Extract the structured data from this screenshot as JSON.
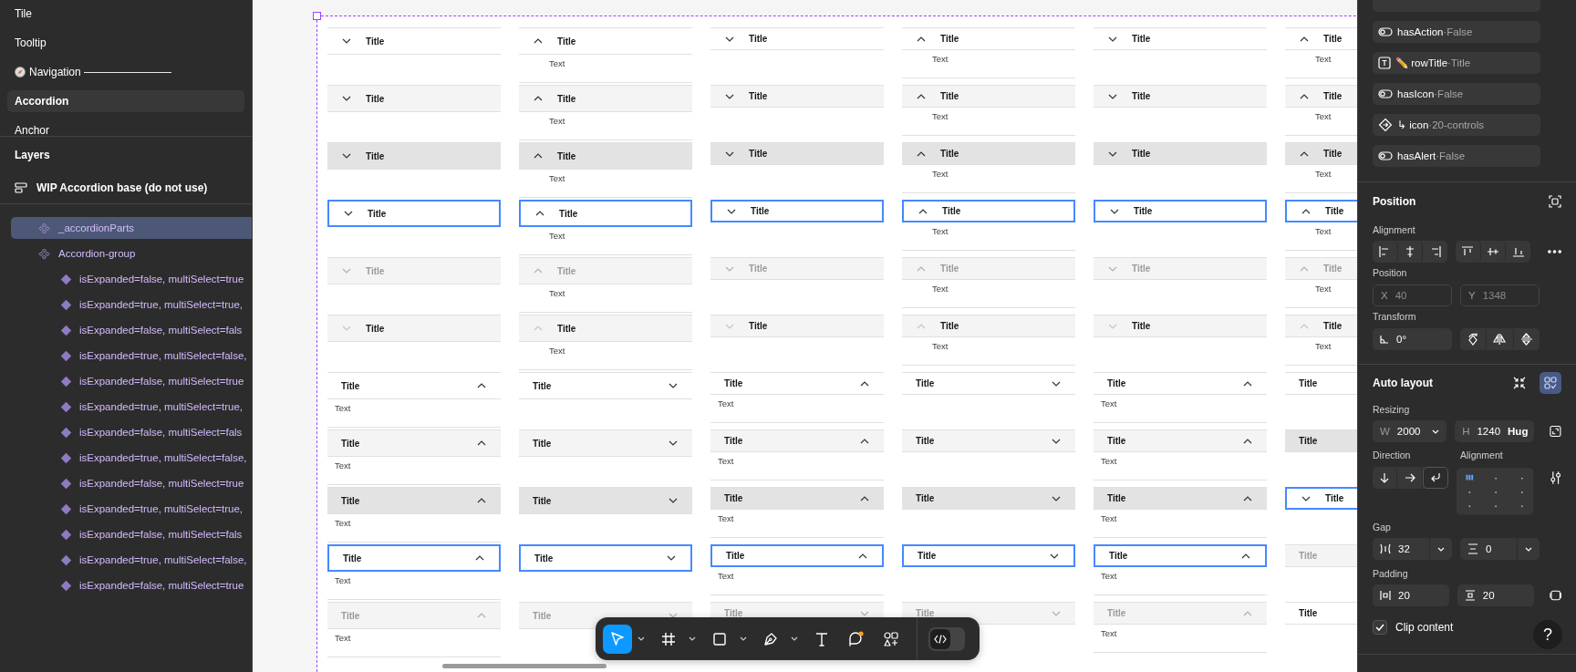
{
  "left_panel": {
    "pages": [
      {
        "label": "Tile",
        "kind": "plain",
        "selected": false
      },
      {
        "label": "Tooltip",
        "kind": "plain",
        "selected": false
      },
      {
        "label": "Navigation ————————",
        "kind": "emoji",
        "selected": false
      },
      {
        "label": "Accordion",
        "kind": "plain",
        "selected": true
      },
      {
        "label": "Anchor",
        "kind": "plain",
        "selected": false
      }
    ],
    "layers_title": "Layers",
    "frame": {
      "label": "WIP Accordion base (do not use)"
    },
    "layers": [
      {
        "label": "_accordionParts",
        "kind": "component-set",
        "selected": true
      },
      {
        "label": "Accordion-group",
        "kind": "component-set",
        "selected": false
      },
      {
        "label": "isExpanded=false, multiSelect=true",
        "kind": "variant",
        "selected": false
      },
      {
        "label": "isExpanded=true, multiSelect=true,",
        "kind": "variant",
        "selected": false
      },
      {
        "label": "isExpanded=false, multiSelect=fals",
        "kind": "variant",
        "selected": false
      },
      {
        "label": "isExpanded=true, multiSelect=false,",
        "kind": "variant",
        "selected": false
      },
      {
        "label": "isExpanded=false, multiSelect=true",
        "kind": "variant",
        "selected": false
      },
      {
        "label": "isExpanded=true, multiSelect=true,",
        "kind": "variant",
        "selected": false
      },
      {
        "label": "isExpanded=false, multiSelect=fals",
        "kind": "variant",
        "selected": false
      },
      {
        "label": "isExpanded=true, multiSelect=false,",
        "kind": "variant",
        "selected": false
      },
      {
        "label": "isExpanded=false, multiSelect=true",
        "kind": "variant",
        "selected": false
      },
      {
        "label": "isExpanded=true, multiSelect=true,",
        "kind": "variant",
        "selected": false
      },
      {
        "label": "isExpanded=false, multiSelect=fals",
        "kind": "variant",
        "selected": false
      },
      {
        "label": "isExpanded=true, multiSelect=false,",
        "kind": "variant",
        "selected": false
      },
      {
        "label": "isExpanded=false, multiSelect=true",
        "kind": "variant",
        "selected": false
      }
    ]
  },
  "canvas": {
    "columns": [
      {
        "kind": "large",
        "cells": [
          {
            "title": "Title",
            "kind": "default",
            "expanded": false,
            "chevron_right": false
          },
          {
            "title": "Title",
            "kind": "hover",
            "expanded": false,
            "chevron_right": false
          },
          {
            "title": "Title",
            "kind": "pressed",
            "expanded": false,
            "chevron_right": false
          },
          {
            "title": "Title",
            "kind": "focus",
            "expanded": false,
            "chevron_right": false
          },
          {
            "title": "Title",
            "kind": "disabled",
            "expanded": false,
            "chevron_right": false
          },
          {
            "title": "Title",
            "kind": "subtle",
            "expanded": false,
            "chevron_right": false
          },
          {
            "title": "Title",
            "kind": "default",
            "expanded": true,
            "chevron_right": true,
            "text": "Text"
          },
          {
            "title": "Title",
            "kind": "hover",
            "expanded": true,
            "chevron_right": true,
            "text": "Text"
          },
          {
            "title": "Title",
            "kind": "pressed",
            "expanded": true,
            "chevron_right": true,
            "text": "Text"
          },
          {
            "title": "Title",
            "kind": "focus",
            "expanded": true,
            "chevron_right": true,
            "text": "Text"
          },
          {
            "title": "Title",
            "kind": "disabled",
            "expanded": true,
            "chevron_right": true,
            "text": "Text"
          }
        ]
      },
      {
        "kind": "large",
        "cells": [
          {
            "title": "Title",
            "kind": "default",
            "expanded": true,
            "chevron_right": false,
            "text": "Text"
          },
          {
            "title": "Title",
            "kind": "hover",
            "expanded": true,
            "chevron_right": false,
            "text": "Text"
          },
          {
            "title": "Title",
            "kind": "pressed",
            "expanded": true,
            "chevron_right": false,
            "text": "Text"
          },
          {
            "title": "Title",
            "kind": "focus",
            "expanded": true,
            "chevron_right": false,
            "text": "Text"
          },
          {
            "title": "Title",
            "kind": "disabled",
            "expanded": true,
            "chevron_right": false,
            "text": "Text"
          },
          {
            "title": "Title",
            "kind": "subtle",
            "expanded": true,
            "chevron_right": false,
            "text": "Text"
          },
          {
            "title": "Title",
            "kind": "default",
            "expanded": false,
            "chevron_right": true
          },
          {
            "title": "Title",
            "kind": "hover",
            "expanded": false,
            "chevron_right": true
          },
          {
            "title": "Title",
            "kind": "pressed",
            "expanded": false,
            "chevron_right": true
          },
          {
            "title": "Title",
            "kind": "focus",
            "expanded": false,
            "chevron_right": true
          },
          {
            "title": "Title",
            "kind": "disabled",
            "expanded": false,
            "chevron_right": true
          }
        ]
      },
      {
        "kind": "small",
        "cells": [
          {
            "title": "Title",
            "kind": "default",
            "expanded": false,
            "chevron_right": false
          },
          {
            "title": "Title",
            "kind": "hover",
            "expanded": false,
            "chevron_right": false
          },
          {
            "title": "Title",
            "kind": "pressed",
            "expanded": false,
            "chevron_right": false
          },
          {
            "title": "Title",
            "kind": "focus",
            "expanded": false,
            "chevron_right": false
          },
          {
            "title": "Title",
            "kind": "disabled",
            "expanded": false,
            "chevron_right": false
          },
          {
            "title": "Title",
            "kind": "subtle",
            "expanded": false,
            "chevron_right": false
          },
          {
            "title": "Title",
            "kind": "default",
            "expanded": true,
            "chevron_right": true,
            "text": "Text"
          },
          {
            "title": "Title",
            "kind": "hover",
            "expanded": true,
            "chevron_right": true,
            "text": "Text"
          },
          {
            "title": "Title",
            "kind": "pressed",
            "expanded": true,
            "chevron_right": true,
            "text": "Text"
          },
          {
            "title": "Title",
            "kind": "focus",
            "expanded": true,
            "chevron_right": true,
            "text": "Text"
          },
          {
            "title": "Title",
            "kind": "disabled",
            "expanded": false,
            "chevron_right": true
          }
        ]
      },
      {
        "kind": "small",
        "cells": [
          {
            "title": "Title",
            "kind": "default",
            "expanded": true,
            "chevron_right": false,
            "text": "Text"
          },
          {
            "title": "Title",
            "kind": "hover",
            "expanded": true,
            "chevron_right": false,
            "text": "Text"
          },
          {
            "title": "Title",
            "kind": "pressed",
            "expanded": true,
            "chevron_right": false,
            "text": "Text"
          },
          {
            "title": "Title",
            "kind": "focus",
            "expanded": true,
            "chevron_right": false,
            "text": "Text"
          },
          {
            "title": "Title",
            "kind": "disabled",
            "expanded": true,
            "chevron_right": false,
            "text": "Text"
          },
          {
            "title": "Title",
            "kind": "subtle",
            "expanded": true,
            "chevron_right": false,
            "text": "Text"
          },
          {
            "title": "Title",
            "kind": "default",
            "expanded": false,
            "chevron_right": true
          },
          {
            "title": "Title",
            "kind": "hover",
            "expanded": false,
            "chevron_right": true
          },
          {
            "title": "Title",
            "kind": "pressed",
            "expanded": false,
            "chevron_right": true
          },
          {
            "title": "Title",
            "kind": "focus",
            "expanded": false,
            "chevron_right": true
          },
          {
            "title": "Title",
            "kind": "disabled",
            "expanded": false,
            "chevron_right": true
          }
        ]
      },
      {
        "kind": "small",
        "cells": [
          {
            "title": "Title",
            "kind": "default",
            "expanded": false,
            "chevron_right": false
          },
          {
            "title": "Title",
            "kind": "hover",
            "expanded": false,
            "chevron_right": false
          },
          {
            "title": "Title",
            "kind": "pressed",
            "expanded": false,
            "chevron_right": false
          },
          {
            "title": "Title",
            "kind": "focus",
            "expanded": false,
            "chevron_right": false
          },
          {
            "title": "Title",
            "kind": "disabled",
            "expanded": false,
            "chevron_right": false
          },
          {
            "title": "Title",
            "kind": "subtle",
            "expanded": false,
            "chevron_right": false
          },
          {
            "title": "Title",
            "kind": "default",
            "expanded": true,
            "chevron_right": true,
            "text": "Text"
          },
          {
            "title": "Title",
            "kind": "hover",
            "expanded": true,
            "chevron_right": true,
            "text": "Text"
          },
          {
            "title": "Title",
            "kind": "pressed",
            "expanded": true,
            "chevron_right": true,
            "text": "Text"
          },
          {
            "title": "Title",
            "kind": "focus",
            "expanded": true,
            "chevron_right": true,
            "text": "Text"
          },
          {
            "title": "Title",
            "kind": "disabled",
            "expanded": true,
            "chevron_right": true,
            "text": "Text"
          }
        ]
      },
      {
        "kind": "small",
        "cells": [
          {
            "title": "Title",
            "kind": "default",
            "expanded": true,
            "chevron_right": false,
            "text": "Text"
          },
          {
            "title": "Title",
            "kind": "hover",
            "expanded": true,
            "chevron_right": false,
            "text": "Text"
          },
          {
            "title": "Title",
            "kind": "pressed",
            "expanded": true,
            "chevron_right": false,
            "text": "Text"
          },
          {
            "title": "Title",
            "kind": "focus",
            "expanded": true,
            "chevron_right": false,
            "text": "Text"
          },
          {
            "title": "Title",
            "kind": "disabled",
            "expanded": true,
            "chevron_right": false,
            "text": "Text"
          },
          {
            "title": "Title",
            "kind": "subtle",
            "expanded": true,
            "chevron_right": false,
            "text": "Text"
          },
          {
            "title": "Title",
            "kind": "default",
            "expanded": false,
            "chevron_right": true
          },
          {
            "title": "Title",
            "kind": "pressed",
            "expanded": false,
            "chevron_right": true
          },
          {
            "title": "Title",
            "kind": "focus",
            "expanded": false,
            "chevron_right": false
          },
          {
            "title": "Title",
            "kind": "disabled",
            "expanded": false,
            "chevron_right": true
          },
          {
            "title": "Title",
            "kind": "default",
            "expanded": false,
            "chevron_right": true
          }
        ]
      }
    ]
  },
  "toolbar": {
    "tools": [
      {
        "kind": "move",
        "selected": true,
        "menu": true
      },
      {
        "kind": "frame",
        "selected": false,
        "menu": true
      },
      {
        "kind": "rectangle",
        "selected": false,
        "menu": true
      },
      {
        "kind": "pen",
        "selected": false,
        "menu": true
      },
      {
        "kind": "text",
        "selected": false,
        "menu": false
      },
      {
        "kind": "comment",
        "selected": false,
        "menu": false,
        "badge": true
      },
      {
        "kind": "actions",
        "selected": false,
        "menu": false
      }
    ],
    "dev_mode": {
      "on": false
    }
  },
  "right_panel": {
    "properties": [
      {
        "kind": "boolean",
        "name": "hasAction",
        "value": "·False"
      },
      {
        "kind": "text",
        "name": "✏️ rowTitle",
        "value": "·Title"
      },
      {
        "kind": "boolean",
        "name": "hasIcon",
        "value": "·False"
      },
      {
        "kind": "instance",
        "name": "↳ icon",
        "value": "·20-controls"
      },
      {
        "kind": "boolean",
        "name": "hasAlert",
        "value": "·False"
      }
    ],
    "position": {
      "title": "Position",
      "alignment_label": "Alignment",
      "position_label": "Position",
      "x": {
        "label": "X",
        "value": "40",
        "disabled": true
      },
      "y": {
        "label": "Y",
        "value": "1348",
        "disabled": true
      },
      "transform_label": "Transform",
      "rotation": "0°"
    },
    "auto_layout": {
      "title": "Auto layout",
      "modes": [
        {
          "kind": "collapse",
          "selected": false
        },
        {
          "kind": "grid",
          "selected": true
        }
      ],
      "resizing_label": "Resizing",
      "width": {
        "label": "W",
        "value": "2000"
      },
      "height": {
        "label": "H",
        "value": "1240",
        "mode": "Hug"
      },
      "direction_label": "Direction",
      "alignment_label": "Alignment",
      "directions": [
        {
          "kind": "down",
          "selected": false
        },
        {
          "kind": "right",
          "selected": false
        },
        {
          "kind": "wrap",
          "selected": true
        }
      ],
      "gap_label": "Gap",
      "gap": {
        "horizontal": "32",
        "vertical": "0"
      },
      "padding_label": "Padding",
      "padding": {
        "horizontal": "20",
        "vertical": "20"
      },
      "clip": {
        "label": "Clip content",
        "checked": true
      }
    },
    "help": {
      "label": "?"
    }
  }
}
